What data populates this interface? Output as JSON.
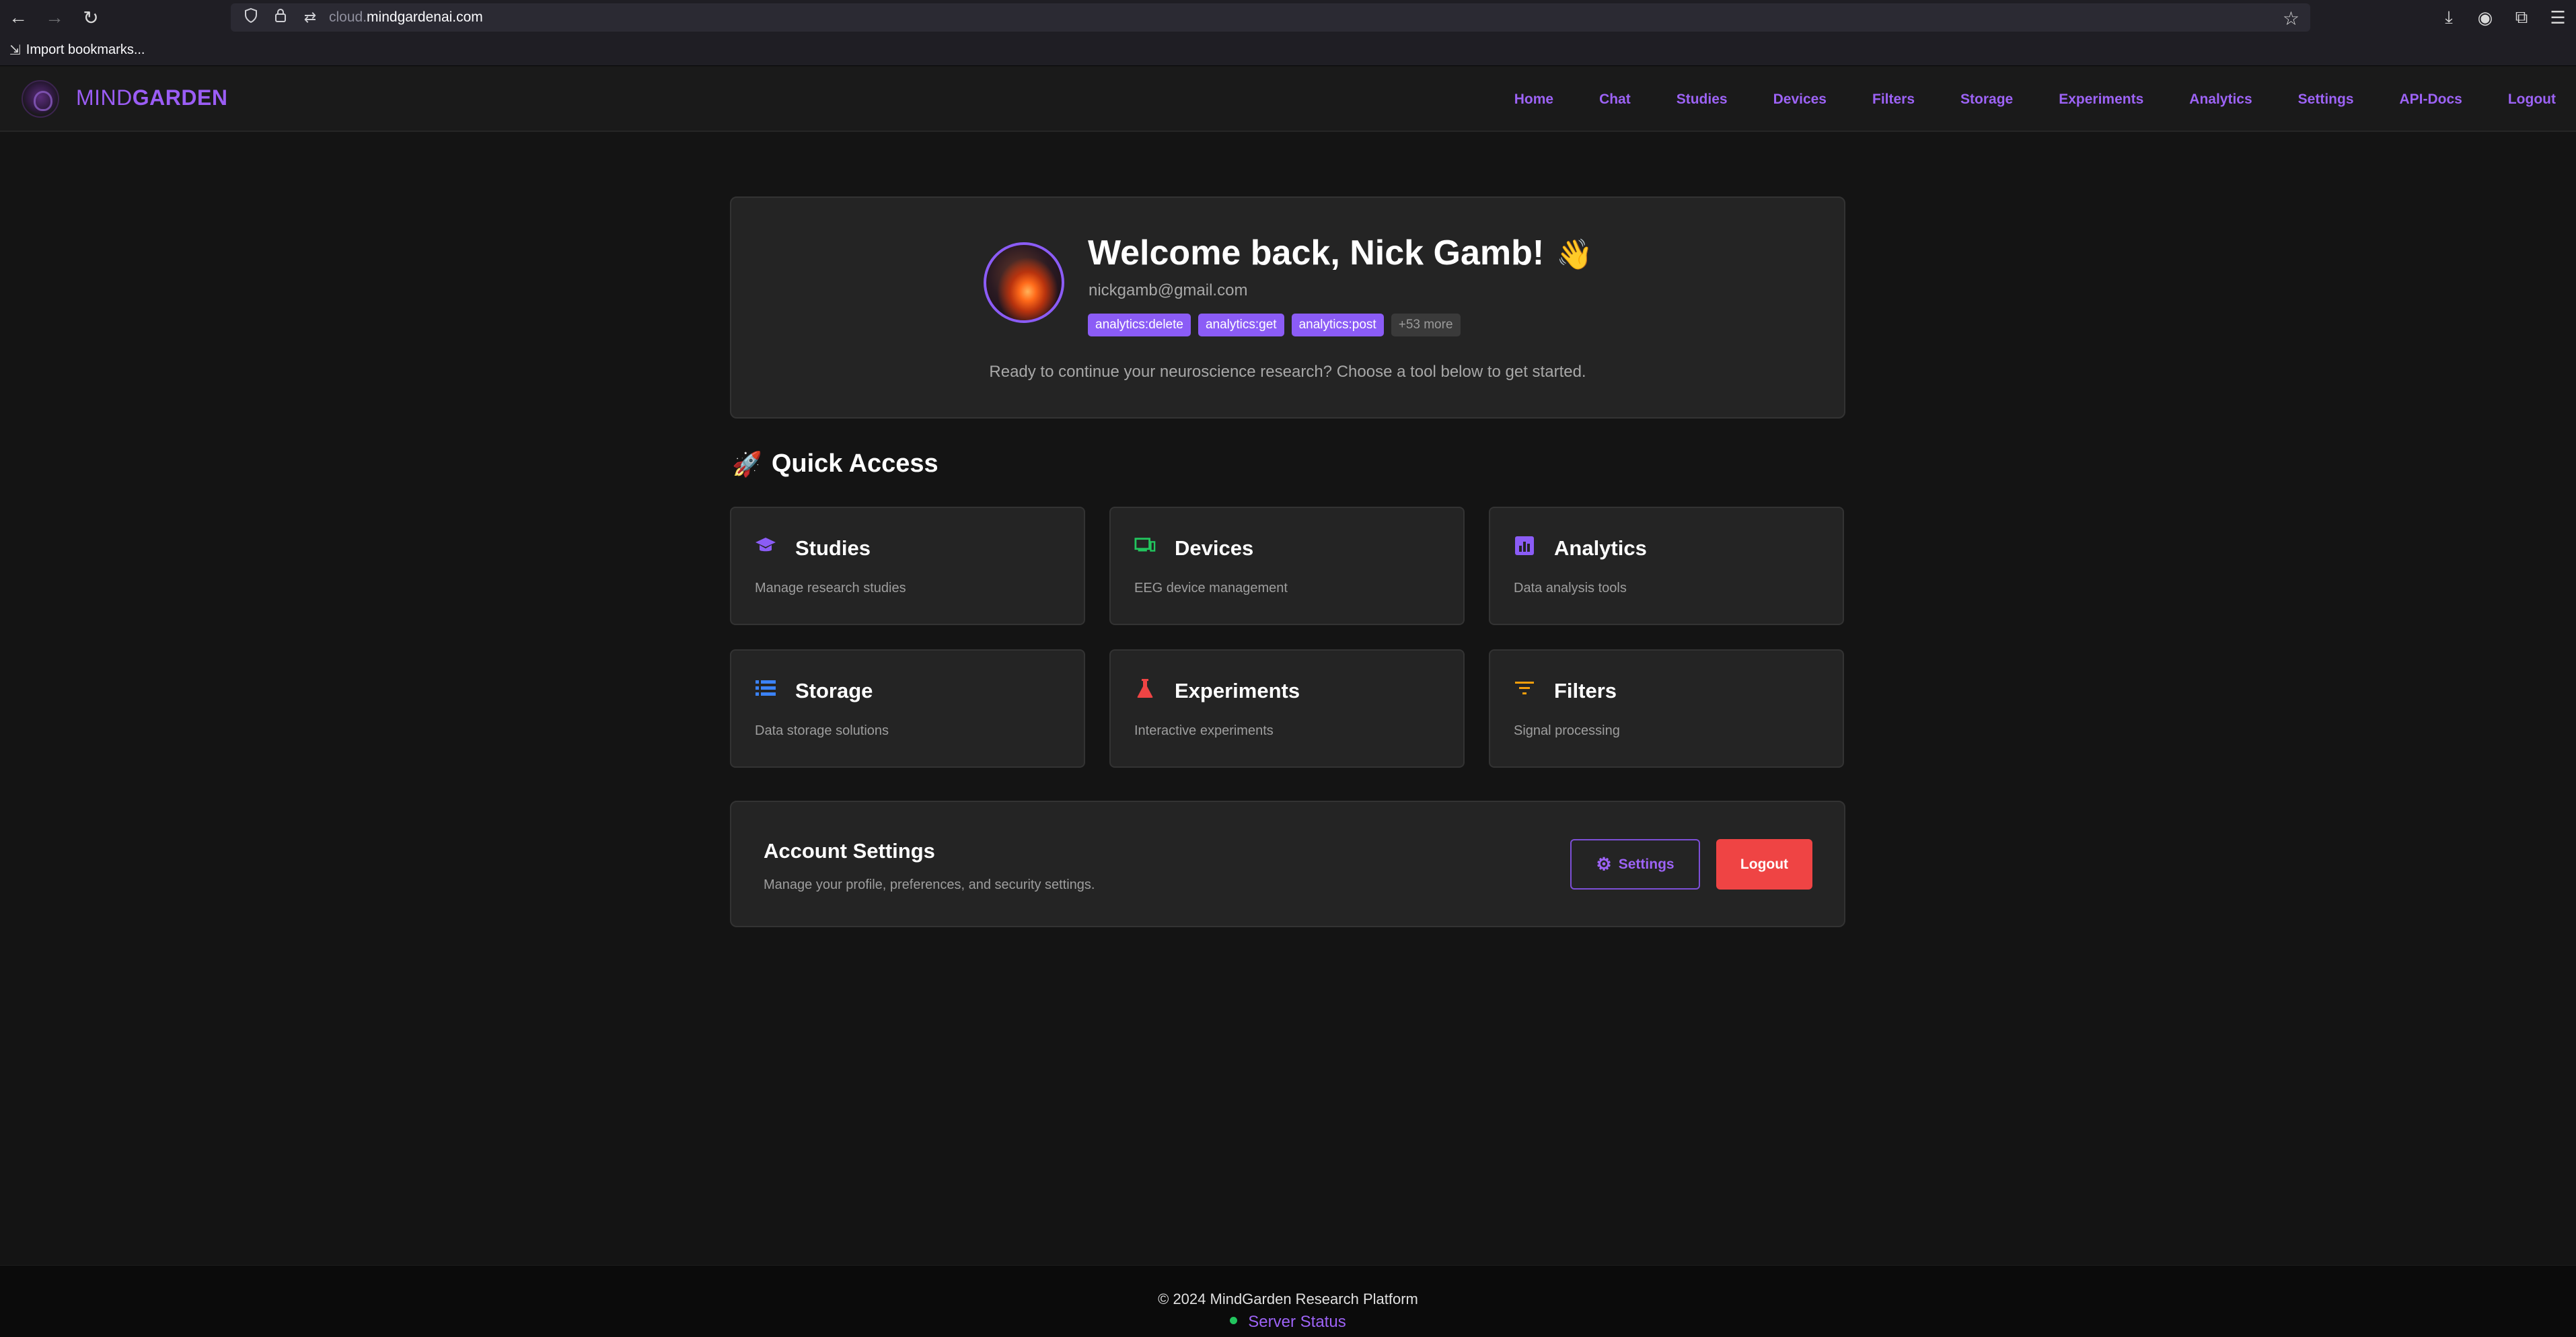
{
  "browser": {
    "url_prefix": "cloud.",
    "url_domain": "mindgardenai.com",
    "bookmarks_label": "Import bookmarks..."
  },
  "header": {
    "brand_light": "MIND",
    "brand_bold": "GARDEN",
    "nav": [
      "Home",
      "Chat",
      "Studies",
      "Devices",
      "Filters",
      "Storage",
      "Experiments",
      "Analytics",
      "Settings",
      "API-Docs",
      "Logout"
    ]
  },
  "welcome": {
    "title": "Welcome back, Nick Gamb!",
    "wave": "👋",
    "email": "nickgamb@gmail.com",
    "tags": [
      "analytics:delete",
      "analytics:get",
      "analytics:post"
    ],
    "more": "+53 more",
    "subtitle": "Ready to continue your neuroscience research? Choose a tool below to get started."
  },
  "quick_access": {
    "heading": "Quick Access",
    "icon": "rocket-icon",
    "cards": [
      {
        "title": "Studies",
        "desc": "Manage research studies",
        "icon": "graduation-cap-icon",
        "color": "#8b5cf6"
      },
      {
        "title": "Devices",
        "desc": "EEG device management",
        "icon": "devices-icon",
        "color": "#22c55e"
      },
      {
        "title": "Analytics",
        "desc": "Data analysis tools",
        "icon": "bar-chart-icon",
        "color": "#8b5cf6"
      },
      {
        "title": "Storage",
        "desc": "Data storage solutions",
        "icon": "list-icon",
        "color": "#3b82f6"
      },
      {
        "title": "Experiments",
        "desc": "Interactive experiments",
        "icon": "flask-icon",
        "color": "#ef4444"
      },
      {
        "title": "Filters",
        "desc": "Signal processing",
        "icon": "filter-icon",
        "color": "#f59e0b"
      }
    ]
  },
  "account": {
    "title": "Account Settings",
    "desc": "Manage your profile, preferences, and security settings.",
    "settings_label": "Settings",
    "logout_label": "Logout"
  },
  "footer": {
    "copyright": "© 2024 MindGarden Research Platform",
    "status": "Server Status"
  }
}
